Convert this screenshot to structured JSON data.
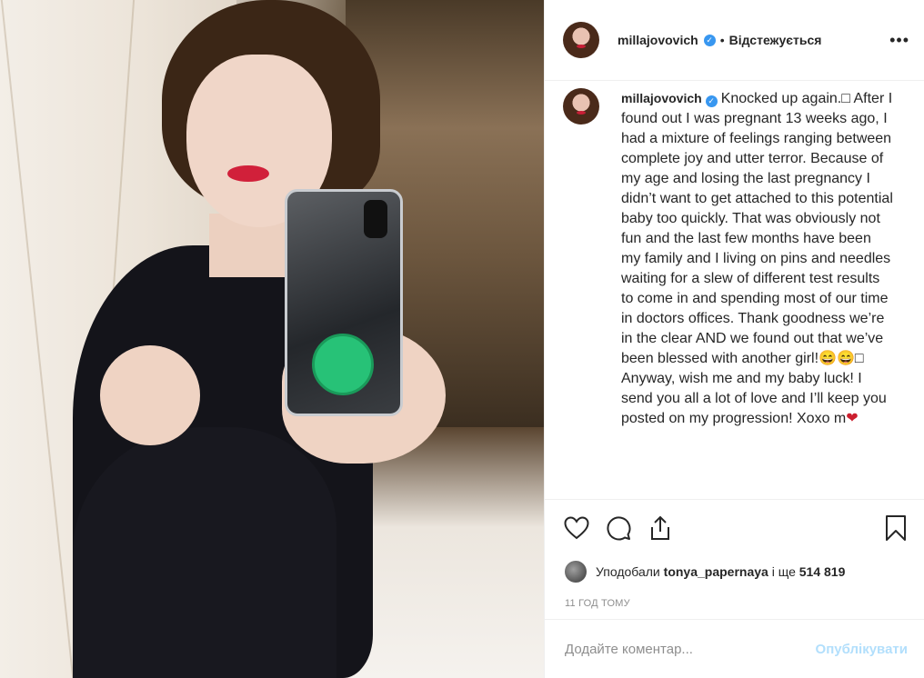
{
  "header": {
    "username": "millajovovich",
    "separator": "•",
    "follow_status": "Відстежується",
    "more_label": "•••",
    "verified_icon": "verified-badge-icon",
    "accent": "#3897f0"
  },
  "caption": {
    "username": "millajovovich",
    "text": "Knocked up again.□ After I found out I was pregnant 13 weeks ago, I had a mixture of feelings ranging between complete joy and utter terror. Because of my age and losing the last pregnancy I didn’t want to get attached to this potential baby too quickly. That was obviously not fun and the last few months have been my family and I living on pins and needles waiting for a slew of different test results to come in and spending most of our time in doctors offices. Thank goodness we’re in the clear AND we found out that we’ve been blessed with another girl!😄😄□ Anyway, wish me and my baby luck! I send you all a lot of love and I’ll keep you posted on my progression! Xoxo m",
    "heart": "❤"
  },
  "actions": {
    "like_icon": "heart-icon",
    "comment_icon": "comment-icon",
    "share_icon": "share-icon",
    "save_icon": "bookmark-icon"
  },
  "likes": {
    "prefix": "Уподобали",
    "user": "tonya_papernaya",
    "middle": "і ще",
    "count": "514 819"
  },
  "timestamp": "11 ГОД ТОМУ",
  "comment": {
    "placeholder": "Додайте коментар...",
    "publish_label": "Опублікувати",
    "publish_color": "#b2dffc"
  }
}
